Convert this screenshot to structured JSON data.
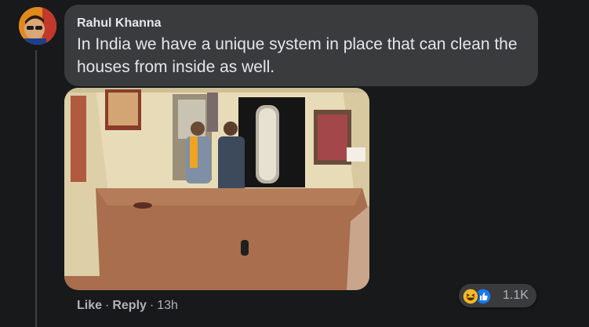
{
  "comment": {
    "author": "Rahul Khanna",
    "text": "In India we have a unique system in place that can clean the houses from inside as well.",
    "timestamp": "13h"
  },
  "actions": {
    "like_label": "Like",
    "reply_label": "Reply",
    "separator": "·"
  },
  "reactions": {
    "types": [
      "laugh-emoji",
      "like-thumb"
    ],
    "count": "1.1K"
  },
  "colors": {
    "background": "#18191a",
    "bubble": "#3a3b3c",
    "text_primary": "#e4e6eb",
    "text_secondary": "#b0b3b8",
    "like_blue": "#1877f2",
    "laugh_yellow": "#f7b928"
  }
}
